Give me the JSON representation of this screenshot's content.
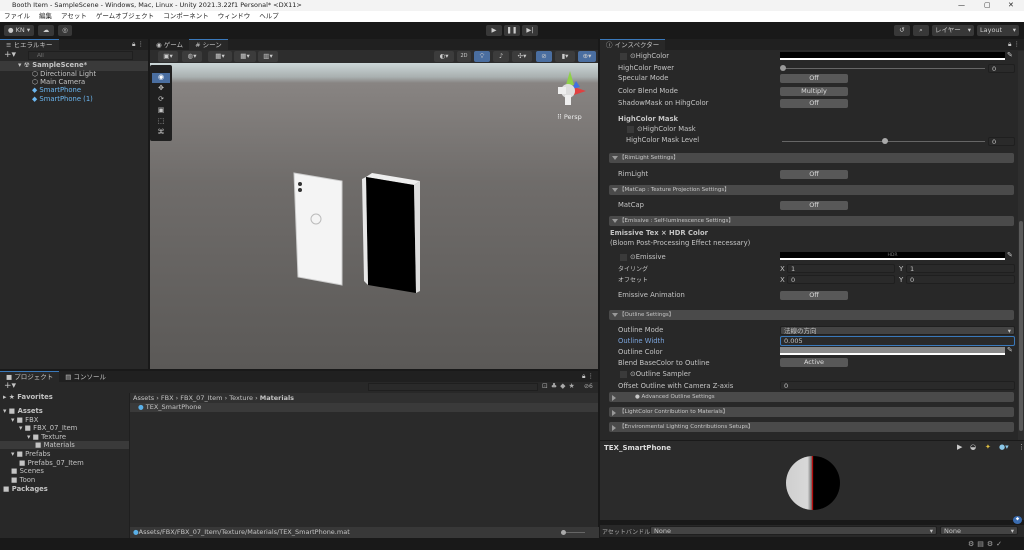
{
  "window": {
    "title": "Booth Item - SampleScene - Windows, Mac, Linux - Unity 2021.3.22f1 Personal* <DX11>"
  },
  "menu": [
    "ファイル",
    "編集",
    "アセット",
    "ゲームオブジェクト",
    "コンポーネント",
    "ウィンドウ",
    "ヘルプ"
  ],
  "toolbar": {
    "account": "KN",
    "layers": "レイヤー",
    "layout": "Layout"
  },
  "hierarchy": {
    "tab": "ヒエラルキー",
    "search_placeholder": "All",
    "scene": "SampleScene*",
    "items": [
      "Directional Light",
      "Main Camera",
      "SmartPhone",
      "SmartPhone (1)"
    ]
  },
  "scene_view": {
    "tabs": [
      "ゲーム",
      "シーン"
    ],
    "mode_2d": "2D",
    "persp": "Persp"
  },
  "inspector": {
    "tab": "インスペクター",
    "highcolor": {
      "label": "HighColor",
      "power_label": "HighColor Power",
      "power": "0",
      "power_value": 0,
      "specular_label": "Specular Mode",
      "specular": "Off",
      "blend_label": "Color Blend Mode",
      "blend": "Multiply",
      "shadowmask_label": "ShadowMask on HihgColor",
      "shadowmask": "Off",
      "mask_title": "HighColor Mask",
      "mask_label": "HighColor Mask",
      "mask_level_label": "HighColor Mask Level",
      "mask_level": "0",
      "mask_level_value": 0.5
    },
    "rimlight": {
      "section": "【RimLight Settings】",
      "label": "RimLight",
      "value": "Off"
    },
    "matcap": {
      "section": "【MatCap : Texture Projection Settings】",
      "label": "MatCap",
      "value": "Off"
    },
    "emissive": {
      "section": "【Emissive : Self-luminescence Settings】",
      "title": "Emissive Tex × HDR Color",
      "note": "(Bloom Post-Processing Effect necessary)",
      "label": "Emissive",
      "hdr": "HDR",
      "tiling_label": "タイリング",
      "offset_label": "オフセット",
      "tiling_x": "1",
      "tiling_y": "1",
      "offset_x": "0",
      "offset_y": "0",
      "anim_label": "Emissive Animation",
      "anim": "Off"
    },
    "outline": {
      "section": "【Outline Settings】",
      "mode_label": "Outline Mode",
      "mode": "法線の方向",
      "width_label": "Outline Width",
      "width": "0.005",
      "color_label": "Outline Color",
      "blend_label": "Blend BaseColor to Outline",
      "blend": "Active",
      "sampler_label": "Outline Sampler",
      "offset_label": "Offset Outline with Camera Z-axis",
      "offset": "0",
      "advanced": "● Advanced Outline Settings"
    },
    "lightcolor_section": "【LightColor Contribution to Materials】",
    "env_section": "【Environmental Lighting Contributions Setups】",
    "preview_title": "TEX_SmartPhone",
    "assetbundle": {
      "label": "アセットバンドル",
      "name": "None",
      "variant": "None"
    }
  },
  "project": {
    "tabs": [
      "プロジェクト",
      "コンソール"
    ],
    "badge": "6",
    "favorites": "Favorites",
    "tree": [
      {
        "label": "Assets",
        "depth": 0,
        "bold": true
      },
      {
        "label": "FBX",
        "depth": 1
      },
      {
        "label": "FBX_07_Item",
        "depth": 2
      },
      {
        "label": "Texture",
        "depth": 3
      },
      {
        "label": "Materials",
        "depth": 4,
        "selected": true
      },
      {
        "label": "Prefabs",
        "depth": 1
      },
      {
        "label": "Prefabs_07_Item",
        "depth": 2
      },
      {
        "label": "Scenes",
        "depth": 1
      },
      {
        "label": "Toon",
        "depth": 1
      },
      {
        "label": "Packages",
        "depth": 0,
        "bold": true
      }
    ],
    "breadcrumb": [
      "Assets",
      "FBX",
      "FBX_07_Item",
      "Texture",
      "Materials"
    ],
    "files": [
      "TEX_SmartPhone"
    ],
    "path": "Assets/FBX/FBX_07_Item/Texture/Materials/TEX_SmartPhone.mat"
  }
}
